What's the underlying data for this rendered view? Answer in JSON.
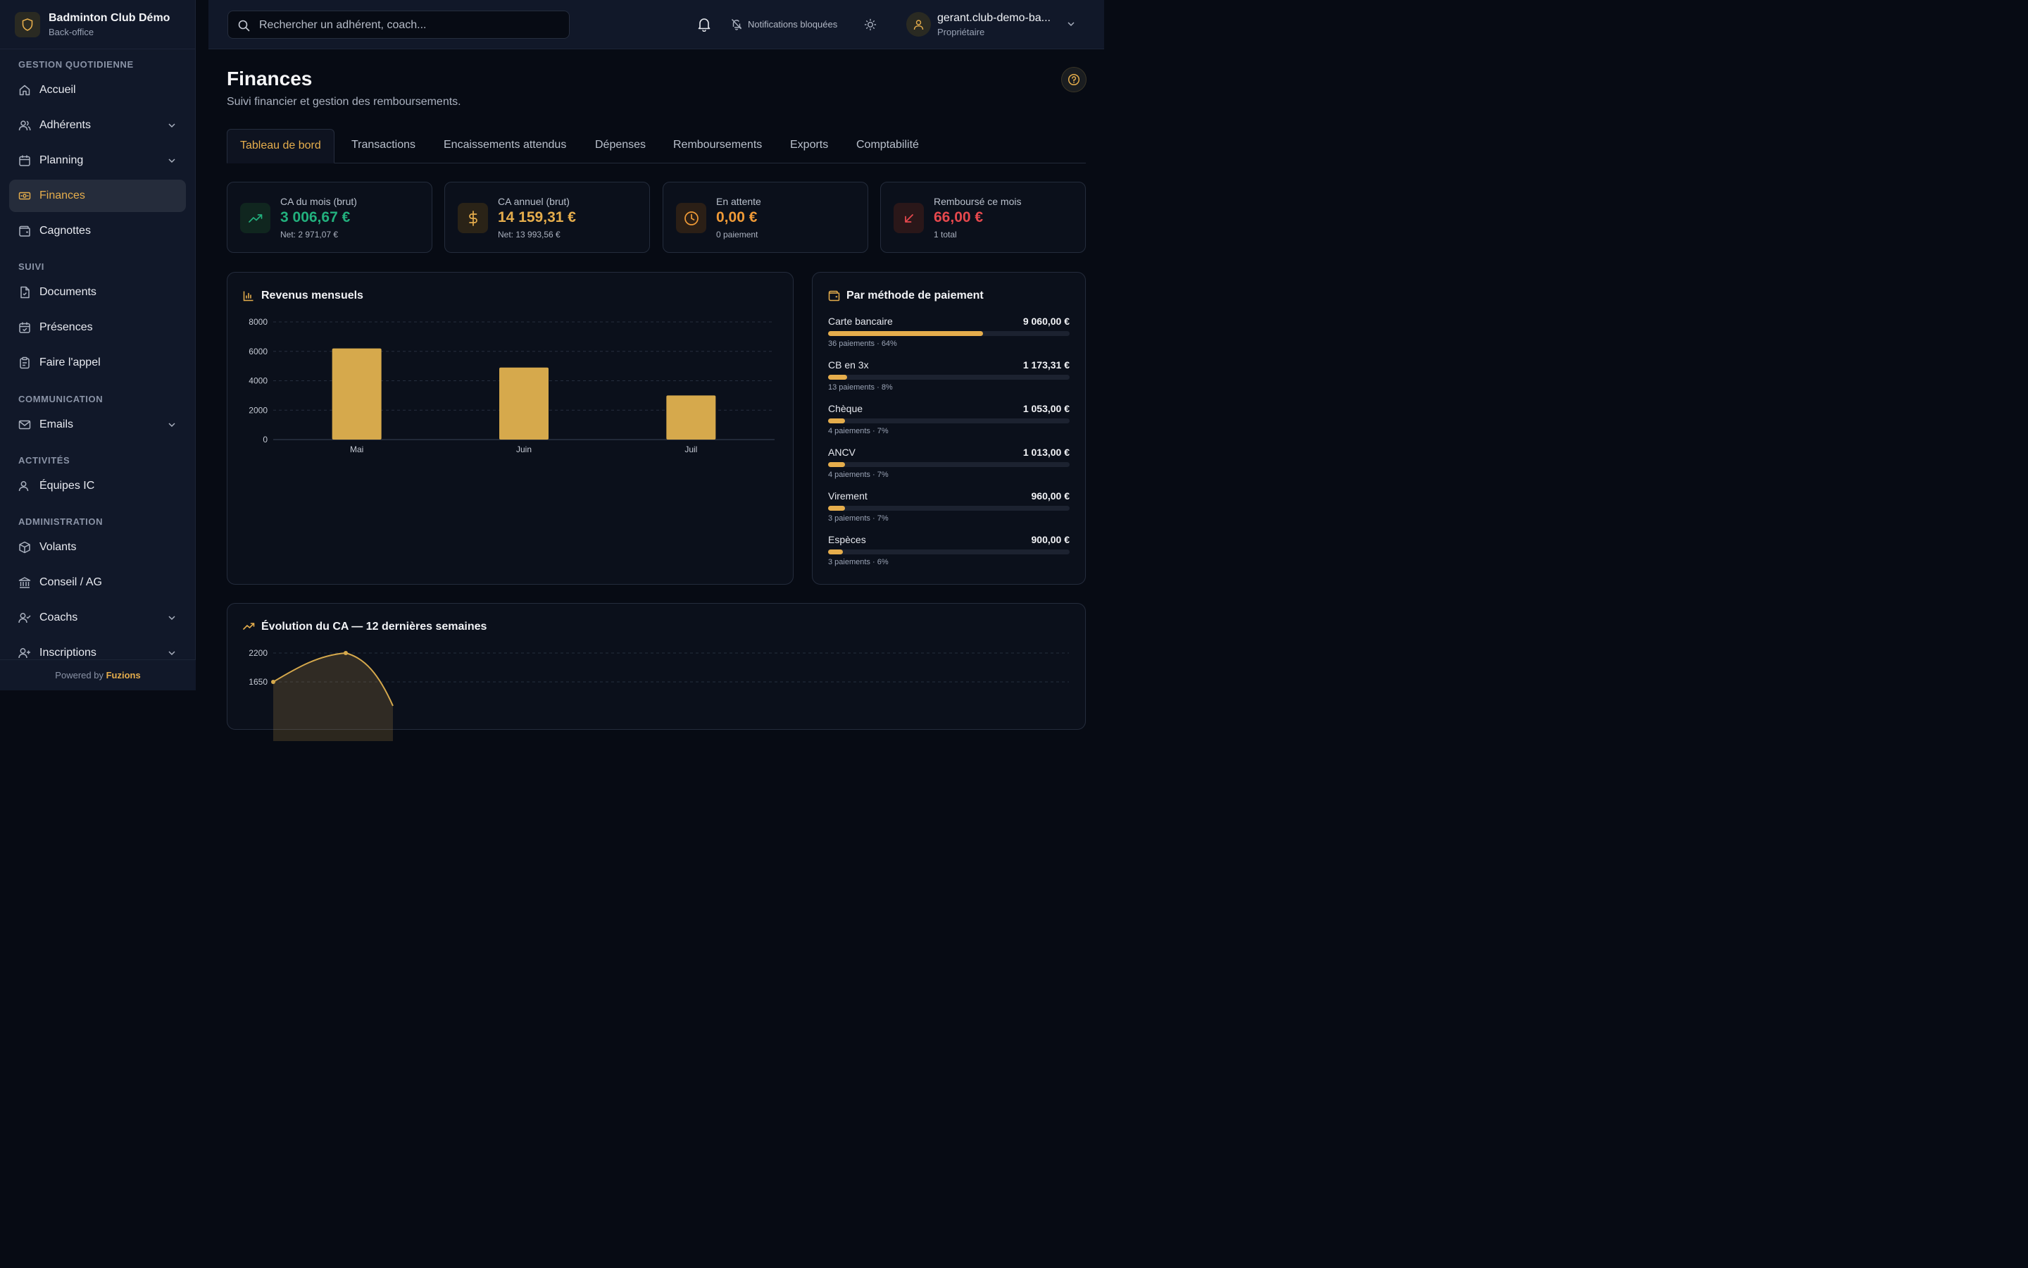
{
  "sidebar": {
    "brand_name": "Badminton Club Démo",
    "brand_sub": "Back-office",
    "sections": [
      "GESTION QUOTIDIENNE",
      "SUIVI",
      "COMMUNICATION",
      "ACTIVITÉS",
      "ADMINISTRATION"
    ],
    "items": [
      {
        "label": "Accueil",
        "icon": "home-icon"
      },
      {
        "label": "Adhérents",
        "icon": "users-icon"
      },
      {
        "label": "Planning",
        "icon": "calendar-icon"
      },
      {
        "label": "Finances",
        "icon": "banknote-icon"
      },
      {
        "label": "Cagnottes",
        "icon": "wallet-icon"
      },
      {
        "label": "Documents",
        "icon": "document-icon"
      },
      {
        "label": "Présences",
        "icon": "calendar-check-icon"
      },
      {
        "label": "Faire l'appel",
        "icon": "clipboard-icon"
      },
      {
        "label": "Emails",
        "icon": "mail-icon"
      },
      {
        "label": "Équipes IC",
        "icon": "team-icon"
      },
      {
        "label": "Volants",
        "icon": "box-icon"
      },
      {
        "label": "Conseil / AG",
        "icon": "bank-icon"
      },
      {
        "label": "Coachs",
        "icon": "user-check-icon"
      },
      {
        "label": "Inscriptions",
        "icon": "user-plus-icon"
      }
    ],
    "footer_prefix": "Powered by",
    "footer_brand": "Fuzions"
  },
  "topbar": {
    "search_placeholder": "Rechercher un adhérent, coach...",
    "notifications_blocked": "Notifications bloquées",
    "user_name": "gerant.club-demo-ba...",
    "user_role": "Propriétaire"
  },
  "page": {
    "title": "Finances",
    "subtitle": "Suivi financier et gestion des remboursements."
  },
  "tabs": [
    "Tableau de bord",
    "Transactions",
    "Encaissements attendus",
    "Dépenses",
    "Remboursements",
    "Exports",
    "Comptabilité"
  ],
  "kpis": [
    {
      "label": "CA du mois (brut)",
      "value": "3 006,67 €",
      "sub": "Net: 2 971,07 €",
      "color": "#22b07d",
      "icon": "trending-up-icon"
    },
    {
      "label": "CA annuel (brut)",
      "value": "14 159,31 €",
      "sub": "Net: 13 993,56 €",
      "color": "#e5ad4c",
      "icon": "dollar-icon"
    },
    {
      "label": "En attente",
      "value": "0,00 €",
      "sub": "0 paiement",
      "color": "#ef9a37",
      "icon": "clock-icon"
    },
    {
      "label": "Remboursé ce mois",
      "value": "66,00 €",
      "sub": "1 total",
      "color": "#e5484d",
      "icon": "arrow-down-left-icon"
    }
  ],
  "chart_data": [
    {
      "type": "bar",
      "title": "Revenus mensuels",
      "categories": [
        "Mai",
        "Juin",
        "Juil"
      ],
      "values": [
        6200,
        4900,
        3000
      ],
      "ylim": [
        0,
        8000
      ],
      "yticks": [
        0,
        2000,
        4000,
        6000,
        8000
      ],
      "grid": true,
      "color": "#d6a94c"
    },
    {
      "type": "area",
      "title": "Évolution du CA — 12 dernières semaines",
      "yticks_visible": [
        1650,
        2200
      ],
      "x": [
        1,
        2,
        3
      ],
      "values": [
        1650,
        2200,
        1400
      ],
      "color": "#d6a94c",
      "grid": true
    }
  ],
  "payment_methods": {
    "title": "Par méthode de paiement",
    "rows": [
      {
        "name": "Carte bancaire",
        "amount": "9 060,00 €",
        "sub": "36 paiements · 64%",
        "pct": 64
      },
      {
        "name": "CB en 3x",
        "amount": "1 173,31 €",
        "sub": "13 paiements · 8%",
        "pct": 8
      },
      {
        "name": "Chèque",
        "amount": "1 053,00 €",
        "sub": "4 paiements · 7%",
        "pct": 7
      },
      {
        "name": "ANCV",
        "amount": "1 013,00 €",
        "sub": "4 paiements · 7%",
        "pct": 7
      },
      {
        "name": "Virement",
        "amount": "960,00 €",
        "sub": "3 paiements · 7%",
        "pct": 7
      },
      {
        "name": "Espèces",
        "amount": "900,00 €",
        "sub": "3 paiements · 6%",
        "pct": 6
      }
    ]
  }
}
